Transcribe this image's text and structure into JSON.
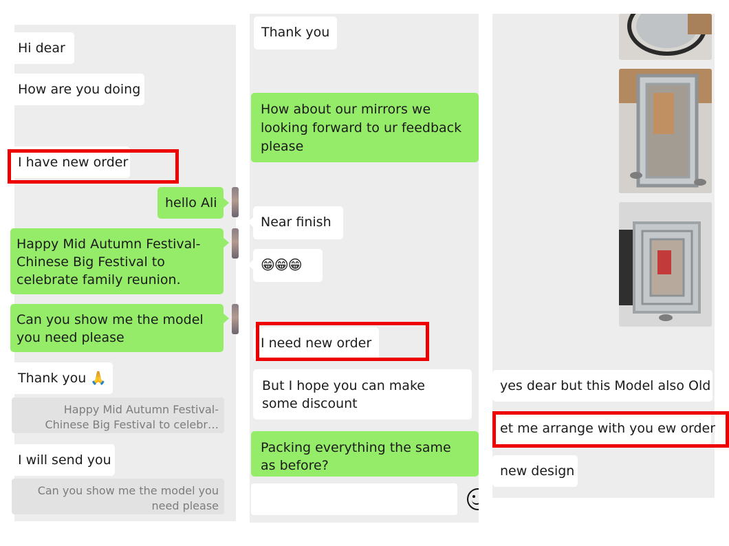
{
  "panel1": {
    "messages": [
      "Hi dear",
      "How are you doing",
      "I have new order",
      "hello Ali",
      "Happy Mid Autumn Festival- Chinese Big Festival to celebrate family reunion.",
      "Can you show me the model you need please",
      "Thank you 🙏",
      "I will send you"
    ],
    "quotes": [
      "Happy Mid Autumn Festival- Chinese Big Festival to celebr…",
      "Can you show me the model you need please"
    ]
  },
  "panel2": {
    "messages": [
      "Thank you",
      "How about our mirrors we looking forward to ur feedback please",
      "Near finish",
      "😁😁😁",
      "I need new order",
      "But I hope you can make some discount",
      "Packing everything the same as before?"
    ],
    "input": {
      "value": ""
    }
  },
  "panel3": {
    "messages": [
      "yes dear but this Model also Old",
      "et me arrange with you ew order",
      "new design"
    ]
  },
  "colors": {
    "sent": "#95ec69",
    "received": "#ffffff",
    "panel": "#ededed",
    "highlight": "#ee0000"
  }
}
